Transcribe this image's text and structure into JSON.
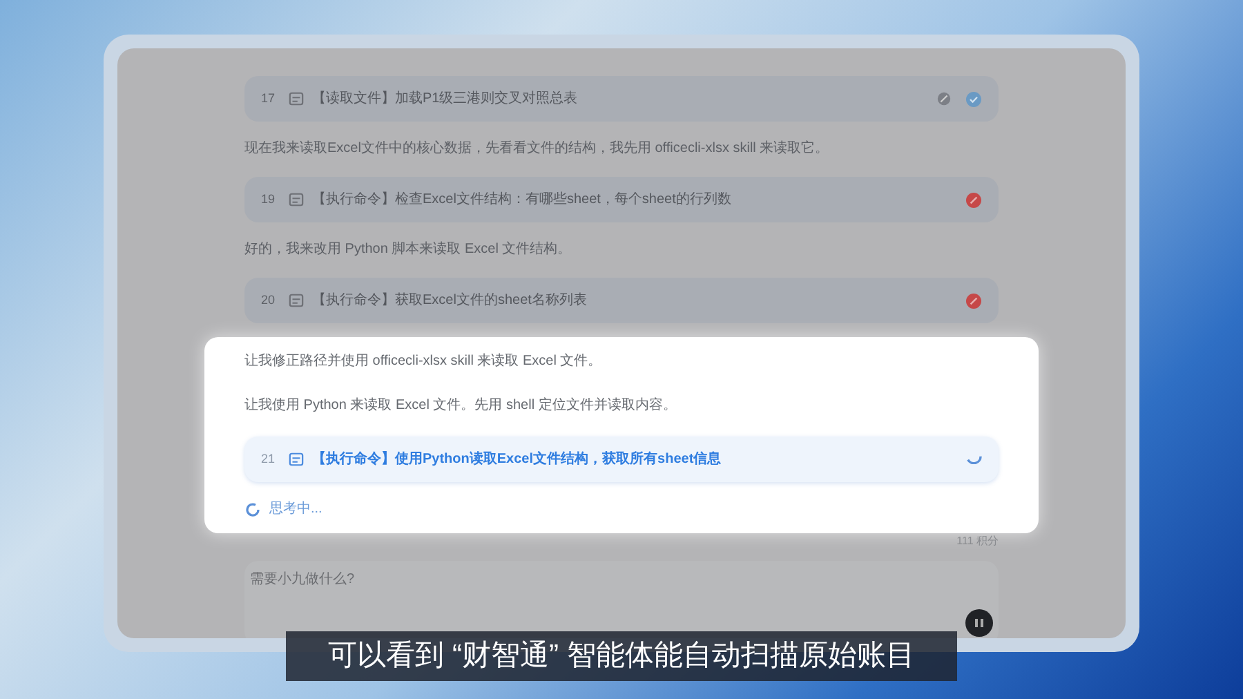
{
  "messages": [
    {
      "kind": "tool",
      "number": "17",
      "text": "【读取文件】加载P1级三港则交叉对照总表",
      "failed": false,
      "running": false,
      "highlighted": false
    },
    {
      "kind": "text",
      "text": "现在我来读取Excel文件中的核心数据，先看看文件的结构，我先用 officecli-xlsx skill 来读取它。",
      "highlighted": false
    },
    {
      "kind": "tool",
      "number": "19",
      "text": "【执行命令】检查Excel文件结构：有哪些sheet，每个sheet的行列数",
      "failed": true,
      "running": false,
      "highlighted": false
    },
    {
      "kind": "text",
      "text": "好的，我来改用 Python 脚本来读取 Excel 文件结构。",
      "highlighted": false
    },
    {
      "kind": "tool",
      "number": "20",
      "text": "【执行命令】获取Excel文件的sheet名称列表",
      "failed": true,
      "running": false,
      "highlighted": false
    },
    {
      "kind": "text",
      "text": "让我修正路径并使用 officecli-xlsx skill 来读取 Excel 文件。",
      "highlighted": true
    },
    {
      "kind": "text",
      "text": "让我使用 Python 来读取 Excel 文件。先用 shell 定位文件并读取内容。",
      "highlighted": true
    },
    {
      "kind": "tool",
      "number": "21",
      "text": "【执行命令】使用Python读取Excel文件结构，获取所有sheet信息",
      "failed": false,
      "running": true,
      "highlighted": true
    }
  ],
  "thinking": {
    "label": "思考中..."
  },
  "credits": "111 积分",
  "composer": {
    "placeholder": "需要小九做什么?"
  },
  "subtitle": "可以看到 “财智通” 智能体能自动扫描原始账目"
}
